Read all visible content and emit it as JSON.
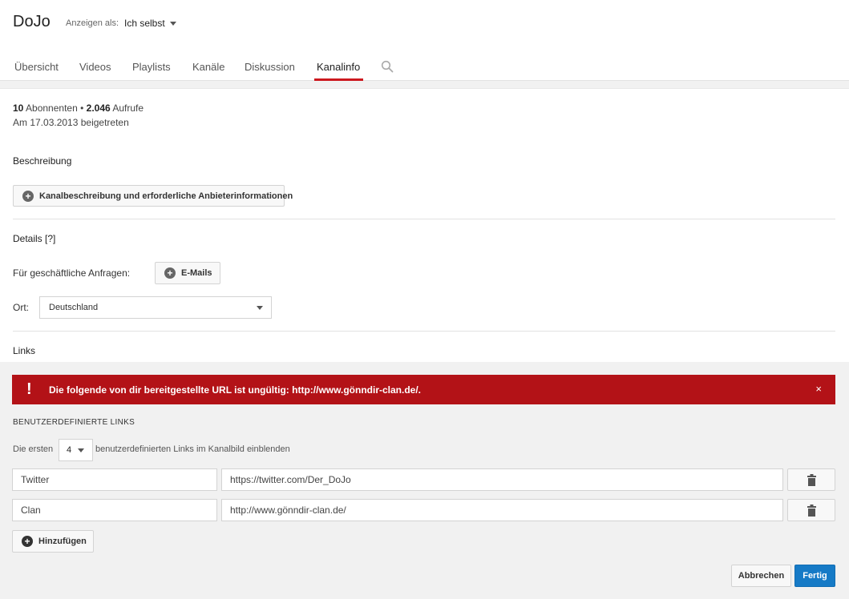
{
  "header": {
    "channel_name": "DoJo",
    "view_as_label": "Anzeigen als:",
    "view_as_value": "Ich selbst",
    "tabs": [
      {
        "label": "Übersicht"
      },
      {
        "label": "Videos"
      },
      {
        "label": "Playlists"
      },
      {
        "label": "Kanäle"
      },
      {
        "label": "Diskussion"
      },
      {
        "label": "Kanalinfo"
      }
    ],
    "active_tab": "Kanalinfo",
    "search_icon": "search-icon"
  },
  "about": {
    "subscribers_count": "10",
    "subscribers_label": "Abonnenten",
    "separator": "•",
    "views_count": "2.046",
    "views_label": "Aufrufe",
    "joined": "Am 17.03.2013 beigetreten",
    "description_title": "Beschreibung",
    "description_button": "Kanalbeschreibung und erforderliche Anbieterinformationen",
    "details_title": "Details [?]",
    "business_label": "Für geschäftliche Anfragen:",
    "email_button": "E-Mails",
    "location_label": "Ort:",
    "location_value": "Deutschland",
    "links_title": "Links"
  },
  "error": {
    "message": "Die folgende von dir bereitgestellte URL ist ungültig: http://www.gönndir-clan.de/.",
    "icon": "!",
    "close": "×",
    "color": "#b31217"
  },
  "custom_links": {
    "heading": "BENUTZERDEFINIERTE LINKS",
    "show_prefix": "Die ersten",
    "show_count": "4",
    "show_suffix": "benutzerdefinierten Links im Kanalbild einblenden",
    "links": [
      {
        "title": "Twitter",
        "url": "https://twitter.com/Der_DoJo"
      },
      {
        "title": "Clan",
        "url": "http://www.gönndir-clan.de/"
      }
    ],
    "add_button": "Hinzufügen"
  },
  "footer": {
    "cancel": "Abbrechen",
    "done": "Fertig",
    "done_color": "#167ac6"
  }
}
